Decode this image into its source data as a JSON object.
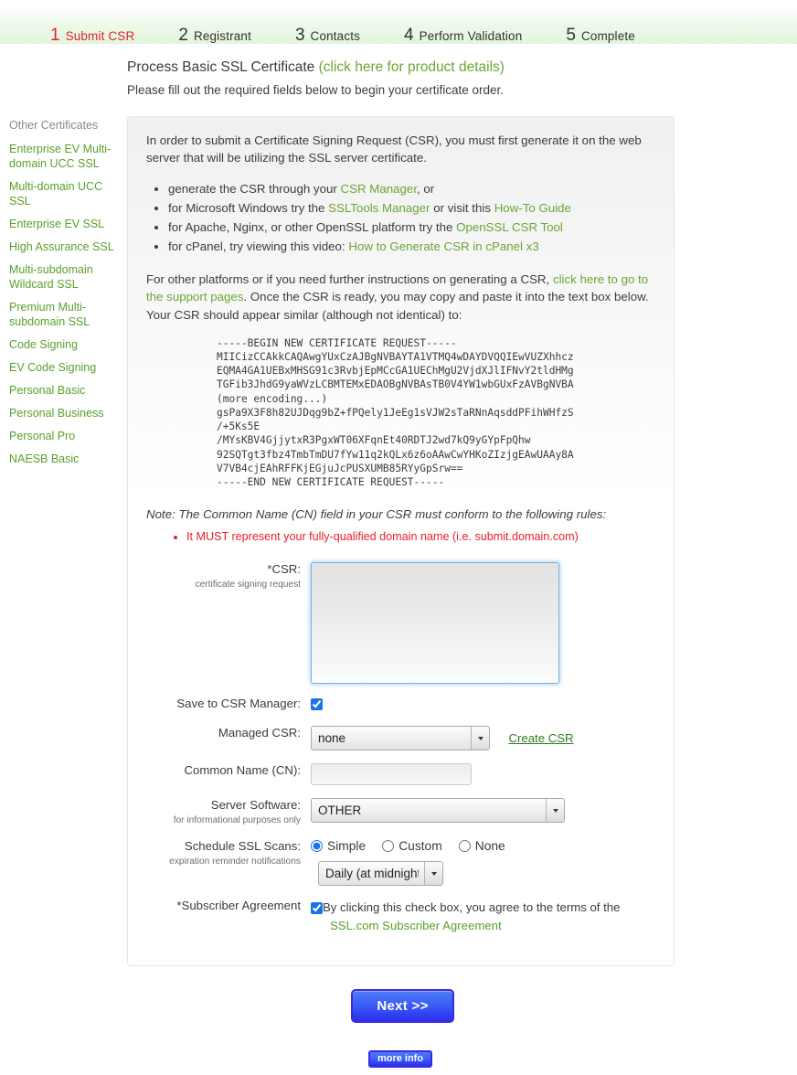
{
  "steps": [
    {
      "num": "1",
      "label": "Submit CSR",
      "active": true
    },
    {
      "num": "2",
      "label": "Registrant",
      "active": false
    },
    {
      "num": "3",
      "label": "Contacts",
      "active": false
    },
    {
      "num": "4",
      "label": "Perform Validation",
      "active": false
    },
    {
      "num": "5",
      "label": "Complete",
      "active": false
    }
  ],
  "header": {
    "title": "Process Basic SSL Certificate",
    "title_link": "(click here for product details)",
    "subtitle": "Please fill out the required fields below to begin your certificate order."
  },
  "sidebar": {
    "title": "Other Certificates",
    "items": [
      {
        "label": "Enterprise EV Multi-domain UCC SSL"
      },
      {
        "label": "Multi-domain UCC SSL"
      },
      {
        "label": "Enterprise EV SSL"
      },
      {
        "label": "High Assurance SSL"
      },
      {
        "label": "Multi-subdomain Wildcard SSL"
      },
      {
        "label": "Premium Multi-subdomain SSL"
      },
      {
        "label": "Code Signing"
      },
      {
        "label": "EV Code Signing"
      },
      {
        "label": "Personal Basic"
      },
      {
        "label": "Personal Business"
      },
      {
        "label": "Personal Pro"
      },
      {
        "label": "NAESB Basic"
      }
    ]
  },
  "panel": {
    "intro": "In order to submit a Certificate Signing Request (CSR), you must first generate it on the web server that will be utilizing the SSL server certificate.",
    "bullets": [
      {
        "pre": "generate the CSR through your ",
        "link1": "CSR Manager",
        "mid": ", or",
        "link2": "",
        "post": ""
      },
      {
        "pre": "for Microsoft Windows try the ",
        "link1": "SSLTools Manager",
        "mid": " or visit this ",
        "link2": "How-To Guide",
        "post": ""
      },
      {
        "pre": "for Apache, Nginx, or other OpenSSL platform try the ",
        "link1": "OpenSSL CSR Tool",
        "mid": "",
        "link2": "",
        "post": ""
      },
      {
        "pre": "for cPanel, try viewing this video: ",
        "link1": "How to Generate CSR in cPanel x3",
        "mid": "",
        "link2": "",
        "post": ""
      }
    ],
    "para2_a": "For other platforms or if you need further instructions on generating a CSR, ",
    "para2_link": "click here to go to the support pages",
    "para2_b": ". Once the CSR is ready, you may copy and paste it into the text box below. Your CSR should appear similar (although not identical) to:",
    "csr_sample": "-----BEGIN NEW CERTIFICATE REQUEST-----\nMIICizCCAkkCAQAwgYUxCzAJBgNVBAYTA1VTMQ4wDAYDVQQIEwVUZXhhcz\nEQMA4GA1UEBxMHSG91c3RvbjEpMCcGA1UEChMgU2VjdXJlIFNvY2tldHMg\nTGFib3JhdG9yaWVzLCBMTEMxEDAOBgNVBAsTB0V4YW1wbGUxFzAVBgNVBA\n(more encoding...)\ngsPa9X3F8h82UJDqg9bZ+fPQely1JeEg1sVJW2sTaRNnAqsddPFihWHfzS\n/+5Ks5E\n/MYsKBV4GjjytxR3PgxWT06XFqnEt40RDTJ2wd7kQ9yGYpFpQhw\n92SQTgt3fbz4TmbTmDU7fYw11q2kQLx6z6oAAwCwYHKoZIzjgEAwUAAy8A\nV7VB4cjEAhRFFKjEGjuJcPUSXUMB85RYyGpSrw==\n-----END NEW CERTIFICATE REQUEST-----",
    "note": "Note: The Common Name (CN) field in your CSR must conform to the following rules:",
    "rules": [
      "It MUST represent your fully-qualified domain name (i.e. submit.domain.com)"
    ]
  },
  "form": {
    "csr": {
      "label": "*CSR:",
      "sublabel": "certificate signing request",
      "value": "",
      "placeholder": ""
    },
    "save_csr_manager": {
      "label": "Save to CSR Manager:",
      "checked": true
    },
    "managed_csr": {
      "label": "Managed CSR:",
      "selected": "none",
      "options": [
        "none"
      ],
      "create_link": "Create CSR"
    },
    "common_name": {
      "label": "Common Name (CN):",
      "value": "",
      "placeholder": ""
    },
    "server_software": {
      "label": "Server Software:",
      "sublabel": "for informational purposes only",
      "selected": "OTHER",
      "options": [
        "OTHER"
      ]
    },
    "schedule_scans": {
      "label": "Schedule SSL Scans:",
      "sublabel": "expiration reminder notifications",
      "options": [
        {
          "label": "Simple",
          "checked": true
        },
        {
          "label": "Custom",
          "checked": false
        },
        {
          "label": "None",
          "checked": false
        }
      ],
      "frequency_selected": "Daily (at midnight)",
      "frequency_options": [
        "Daily (at midnight)"
      ]
    },
    "subscriber_agreement": {
      "label": "*Subscriber Agreement",
      "checked": true,
      "text": "By clicking this check box, you agree to the terms of the",
      "link": "SSL.com Subscriber Agreement"
    }
  },
  "buttons": {
    "next": "Next >>",
    "more_info": "more info"
  },
  "colors": {
    "green_link": "#6aa635",
    "sidebar_green": "#5aa02c",
    "red_active": "#e8202a",
    "button_blue": "#3b5ef5",
    "focus_blue": "#7ab2e0"
  }
}
